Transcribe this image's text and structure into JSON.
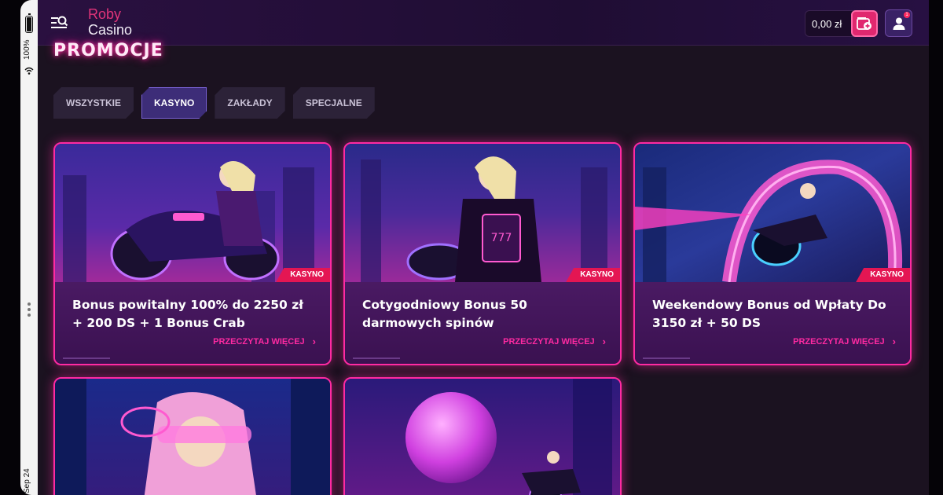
{
  "device": {
    "battery_percent": "100%",
    "date": "Sep 24"
  },
  "header": {
    "logo_line1": "Roby",
    "logo_line2": "Casino",
    "balance": "0,00 zł",
    "notification_count": "1",
    "menu_icon": "menu-search-icon",
    "deposit_icon": "wallet-plus-icon",
    "user_icon": "user-icon"
  },
  "page": {
    "title": "PROMOCJE"
  },
  "filters": [
    {
      "label": "WSZYSTKIE",
      "active": false
    },
    {
      "label": "KASYNO",
      "active": true
    },
    {
      "label": "ZAKŁADY",
      "active": false
    },
    {
      "label": "SPECJALNE",
      "active": false
    }
  ],
  "promotions": [
    {
      "badge": "KASYNO",
      "title": "Bonus powitalny 100% do 2250 zł + 200 DS + 1 Bonus Crab",
      "link": "PRZECZYTAJ WIĘCEJ"
    },
    {
      "badge": "KASYNO",
      "title": "Cotygodniowy Bonus 50 darmowych spinów",
      "link": "PRZECZYTAJ WIĘCEJ"
    },
    {
      "badge": "KASYNO",
      "title": "Weekendowy Bonus od Wpłaty Do 3150 zł + 50 DS",
      "link": "PRZECZYTAJ WIĘCEJ"
    }
  ],
  "colors": {
    "accent_pink": "#ff2aa2",
    "badge_red": "#e41653",
    "header_bg": "#2a1040",
    "page_bg": "#1b1220",
    "tab_active": "#3d2d78"
  }
}
